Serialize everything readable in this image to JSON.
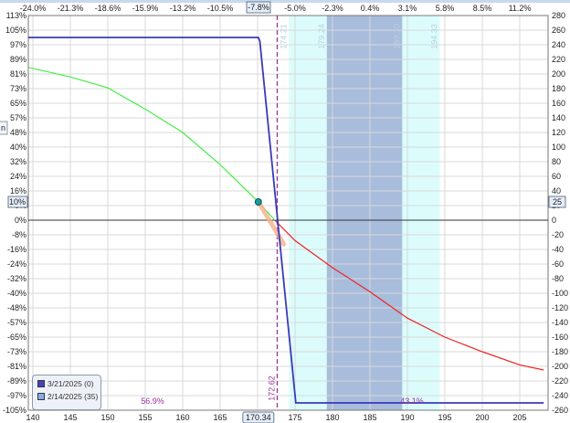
{
  "chart_data": {
    "type": "line",
    "title": "",
    "xlabel": "",
    "ylabel": "",
    "xlim": [
      139.4,
      208.2
    ],
    "ylim": [
      -260,
      280
    ],
    "x_ticks": [
      140,
      145,
      150,
      155,
      160,
      165,
      170,
      175,
      180,
      185,
      190,
      195,
      200,
      205
    ],
    "top_ticks": [
      "-24.0%",
      "-21.3%",
      "-18.6%",
      "-15.9%",
      "-13.2%",
      "-10.5%",
      "-7.8%",
      "-5.0%",
      "-2.3%",
      "0.4%",
      "3.1%",
      "5.8%",
      "8.5%",
      "11.2%"
    ],
    "left_ticks": [
      "113%",
      "105%",
      "97%",
      "89%",
      "81%",
      "73%",
      "65%",
      "57%",
      "48%",
      "40%",
      "32%",
      "24%",
      "16%",
      "8%",
      "0%",
      "-8%",
      "-16%",
      "-24%",
      "-32%",
      "-40%",
      "-48%",
      "-57%",
      "-65%",
      "-73%",
      "-81%",
      "-89%",
      "-97%",
      "-105%"
    ],
    "right_ticks": [
      280,
      260,
      240,
      220,
      200,
      180,
      160,
      140,
      120,
      100,
      80,
      60,
      40,
      20,
      0,
      -20,
      -40,
      -60,
      -80,
      -100,
      -120,
      -140,
      -160,
      -180,
      -200,
      -220,
      -240,
      -260
    ],
    "series": [
      {
        "name": "3/21/2025 (0)",
        "color": "#3a3ab8",
        "points": [
          [
            139.4,
            250
          ],
          [
            170.1,
            250
          ],
          [
            170.3,
            245
          ],
          [
            175.1,
            -250
          ],
          [
            208.2,
            -250
          ]
        ]
      },
      {
        "name": "2/14/2025 (35)",
        "profit_color": "#44ee44",
        "loss_color": "#ee2222",
        "points": [
          [
            139.4,
            209
          ],
          [
            145,
            196
          ],
          [
            150,
            181
          ],
          [
            155,
            152
          ],
          [
            160,
            120
          ],
          [
            165,
            76
          ],
          [
            170.1,
            25
          ],
          [
            172.3,
            0
          ],
          [
            175,
            -28
          ],
          [
            180,
            -65
          ],
          [
            185,
            -98
          ],
          [
            190,
            -134
          ],
          [
            195,
            -160
          ],
          [
            200,
            -180
          ],
          [
            205,
            -198
          ],
          [
            208.2,
            -205
          ]
        ]
      }
    ],
    "bands": {
      "outer": {
        "from": 174.21,
        "to": 194.33,
        "color": "#dcfcfc"
      },
      "inner": {
        "from": 179.24,
        "to": 189.3,
        "color": "#a8bcdc"
      },
      "labels": [
        "174.21",
        "179.24",
        "189.30",
        "194.33"
      ]
    },
    "breakeven": {
      "value": 172.62,
      "label": "172.62"
    },
    "current_price": {
      "value": 170.1,
      "pl": 25,
      "x_label": "170.34",
      "top_label": "-7.8%",
      "left_label": "10%",
      "right_label": "25"
    },
    "hedge_segment": [
      [
        170.1,
        25
      ],
      [
        173.5,
        -33
      ]
    ],
    "probabilities": {
      "below": "56.9%",
      "above": "43.1%"
    },
    "legend": [
      "3/21/2025 (0)",
      "2/14/2025 (35)"
    ],
    "legend_colors": [
      "#4444bb",
      "#8aaee0"
    ],
    "cut_label": "n"
  }
}
